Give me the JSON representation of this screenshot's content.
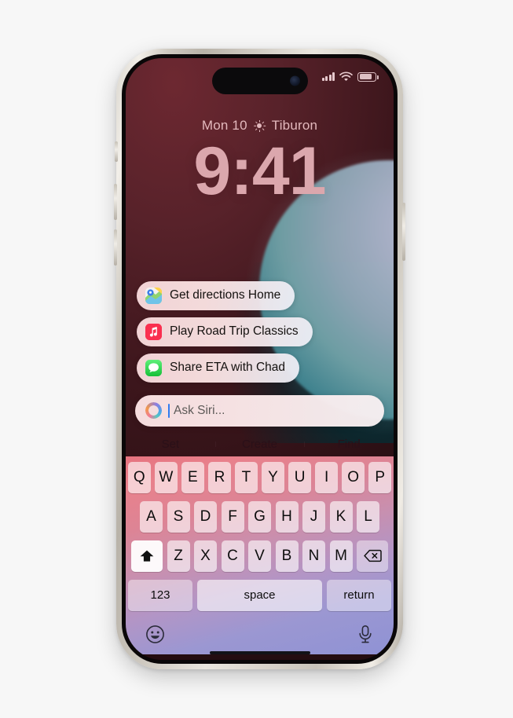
{
  "page": {
    "background": "#f7f7f7"
  },
  "device": {
    "name": "iPhone",
    "frame_color": "#ded9d1",
    "buttons": [
      "silent-switch",
      "volume-up",
      "volume-down",
      "power"
    ]
  },
  "status_bar": {
    "cellular_icon": "cellular-bars-icon",
    "cellular_bars": 4,
    "wifi_icon": "wifi-icon",
    "battery_icon": "battery-icon",
    "battery_level": 70,
    "dynamic_island": "dynamic-island",
    "camera": "front-camera"
  },
  "lock_screen": {
    "date": "Mon 10",
    "weather_icon": "sun-icon",
    "location": "Tiburon",
    "time": "9:41",
    "time_color": "#dba7ad",
    "date_color": "#e3b9bd"
  },
  "wallpaper": {
    "style": "planet",
    "background_color": "#58222a",
    "planet_color": "#8fa6b6",
    "accent_color": "#2c6b78"
  },
  "siri": {
    "suggestions": [
      {
        "icon": "maps-icon",
        "app": "Maps",
        "label": "Get directions Home"
      },
      {
        "icon": "music-icon",
        "app": "Music",
        "label": "Play Road Trip Classics"
      },
      {
        "icon": "messages-icon",
        "app": "Messages",
        "label": "Share ETA with Chad"
      }
    ],
    "input": {
      "icon": "siri-orb-icon",
      "placeholder": "Ask Siri...",
      "value": "",
      "caret_color": "#2f7bf0"
    },
    "quick_actions": [
      {
        "label": "Set"
      },
      {
        "label": "Create"
      },
      {
        "label": "Find"
      }
    ]
  },
  "keyboard": {
    "row1": [
      "Q",
      "W",
      "E",
      "R",
      "T",
      "Y",
      "U",
      "I",
      "O",
      "P"
    ],
    "row2": [
      "A",
      "S",
      "D",
      "F",
      "G",
      "H",
      "J",
      "K",
      "L"
    ],
    "row3_letters": [
      "Z",
      "X",
      "C",
      "V",
      "B",
      "N",
      "M"
    ],
    "shift_key": {
      "icon": "shift-arrow-icon",
      "active": true
    },
    "delete_key": {
      "icon": "delete-backspace-icon"
    },
    "numbers_key": "123",
    "space_key": "space",
    "return_key": "return",
    "emoji_key": {
      "icon": "emoji-smiley-icon"
    },
    "dictation_key": {
      "icon": "microphone-icon"
    },
    "gradient_start": "#e6737f",
    "gradient_end": "#8f92d4"
  },
  "home_indicator": "home-indicator"
}
